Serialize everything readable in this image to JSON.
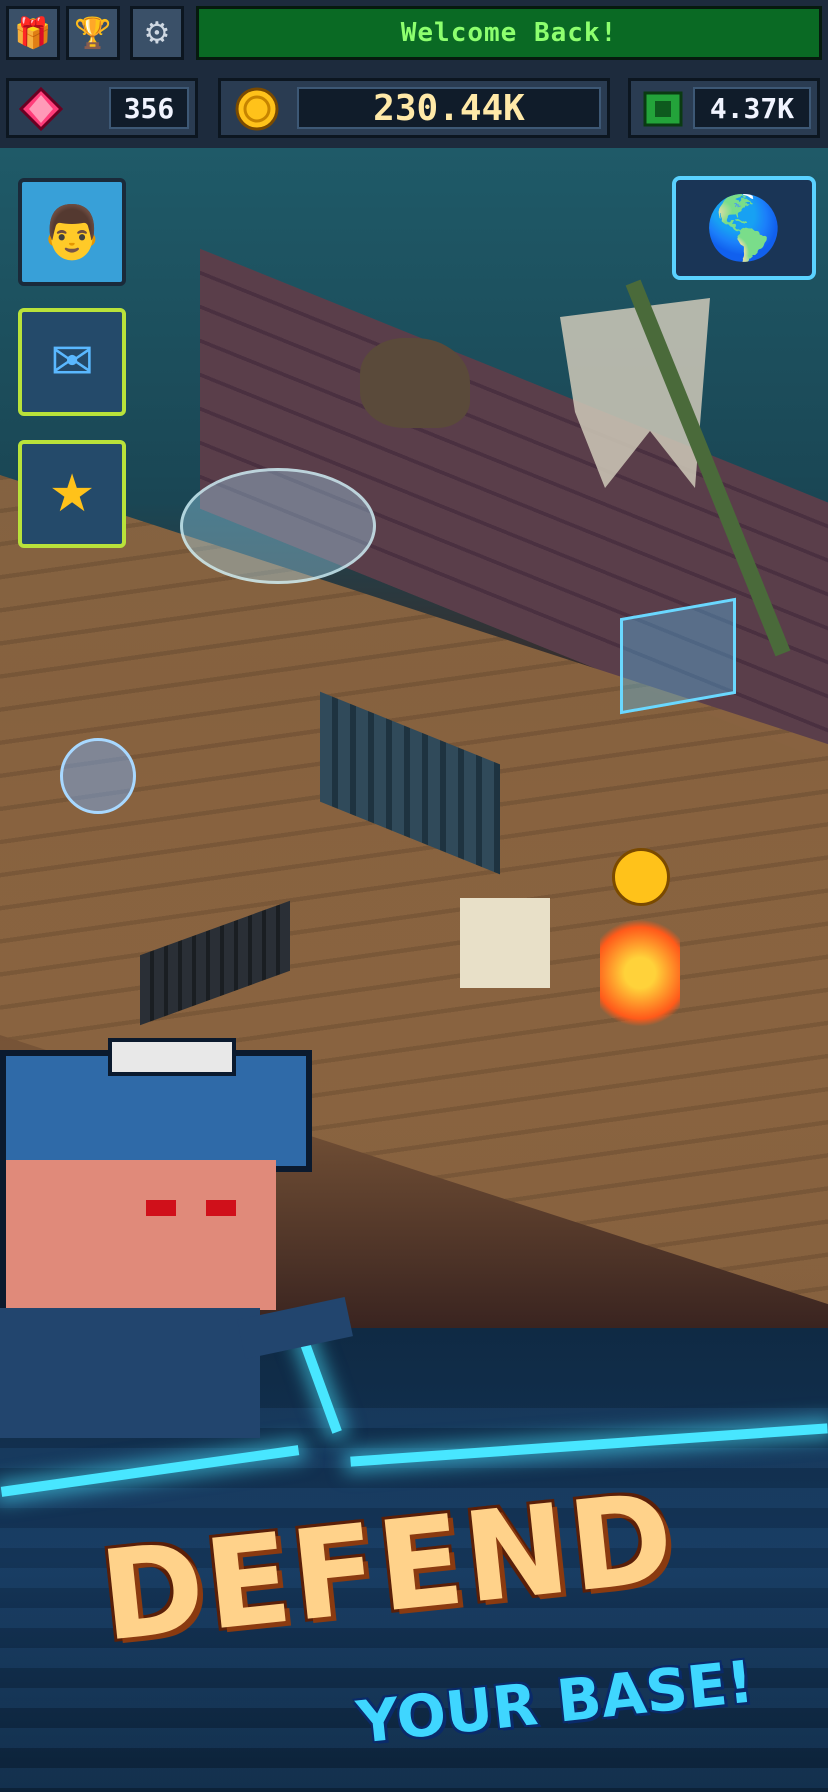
{
  "topbar": {
    "gift_button": "gift-icon",
    "trophy_button": "trophy-icon",
    "settings_button": "gear-icon",
    "welcome_text": "Welcome Back!"
  },
  "resources": {
    "gems": {
      "icon": "gem-icon",
      "value": "356"
    },
    "coins": {
      "icon": "coin-icon",
      "value": "230.44K"
    },
    "cash": {
      "icon": "cash-icon",
      "value": "4.37K"
    }
  },
  "side_buttons": [
    {
      "name": "profile",
      "icon": "avatar-icon"
    },
    {
      "name": "mail",
      "icon": "mail-icon"
    },
    {
      "name": "rewards",
      "icon": "treasure-chest-icon"
    }
  ],
  "world_button": {
    "icon": "globe-icon"
  },
  "promo": {
    "headline": "DEFEND",
    "subline": "YOUR BASE!"
  },
  "colors": {
    "welcome_green": "#8dff6e",
    "neon_cyan": "#48e6ff",
    "headline_orange": "#ffd28a",
    "subline_blue": "#3fd6ff"
  }
}
